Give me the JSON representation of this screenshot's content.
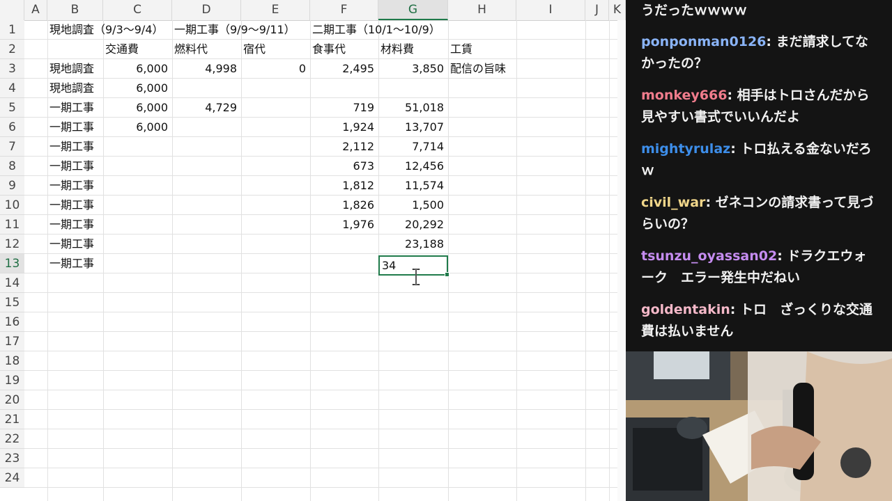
{
  "spreadsheet": {
    "columns": [
      "A",
      "B",
      "C",
      "D",
      "E",
      "F",
      "G",
      "H",
      "I",
      "J",
      "K"
    ],
    "selected_column": "G",
    "rows": [
      "1",
      "2",
      "3",
      "4",
      "5",
      "6",
      "7",
      "8",
      "9",
      "10",
      "11",
      "12",
      "13",
      "14",
      "15",
      "16",
      "17",
      "18",
      "19",
      "20",
      "21",
      "22",
      "23",
      "24"
    ],
    "selected_row": "13",
    "cells": {
      "B1": "現地調査（9/3〜9/4）",
      "D1": "一期工事（9/9〜9/11）",
      "F1": "二期工事（10/1〜10/9）",
      "C2": "交通費",
      "D2": "燃料代",
      "E2": "宿代",
      "F2": "食事代",
      "G2": "材料費",
      "H2": "工賃",
      "B3": "現地調査",
      "C3": "6,000",
      "D3": "4,998",
      "E3": "0",
      "F3": "2,495",
      "G3": "3,850",
      "H3": "配信の旨味",
      "B4": "現地調査",
      "C4": "6,000",
      "B5": "一期工事",
      "C5": "6,000",
      "D5": "4,729",
      "F5": "719",
      "G5": "51,018",
      "B6": "一期工事",
      "C6": "6,000",
      "F6": "1,924",
      "G6": "13,707",
      "B7": "一期工事",
      "F7": "2,112",
      "G7": "7,714",
      "B8": "一期工事",
      "F8": "673",
      "G8": "12,456",
      "B9": "一期工事",
      "F9": "1,812",
      "G9": "11,574",
      "B10": "一期工事",
      "F10": "1,826",
      "G10": "1,500",
      "B11": "一期工事",
      "F11": "1,976",
      "G11": "20,292",
      "B12": "一期工事",
      "G12": "23,188",
      "B13": "一期工事"
    },
    "active_cell": {
      "ref": "G13",
      "editing_value": "34"
    }
  },
  "chat": {
    "messages": [
      {
        "user": "",
        "text": "うだったｗｗｗｗ",
        "color": "#ffffff"
      },
      {
        "user": "ponponman0126",
        "text": "まだ請求してなかったの？",
        "color": "#8ab4f8"
      },
      {
        "user": "monkey666",
        "text": "相手はトロさんだから見やすい書式でいいんだよ",
        "color": "#f07c8c"
      },
      {
        "user": "mightyrulaz",
        "text": "トロ払える金ないだろｗ",
        "color": "#3d8eea"
      },
      {
        "user": "civil_war",
        "text": "ゼネコンの請求書って見づらいの？",
        "color": "#f0d68a"
      },
      {
        "user": "tsunzu_oyassan02",
        "text": "ドラクエウォーク　エラー発生中だねい",
        "color": "#c58cf0"
      },
      {
        "user": "goldentakin",
        "text": "トロ　ざっくりな交通費は払いません",
        "color": "#f4b8c8"
      }
    ]
  },
  "colors": {
    "accent": "#1f7a4a",
    "chat_bg": "#141414"
  }
}
